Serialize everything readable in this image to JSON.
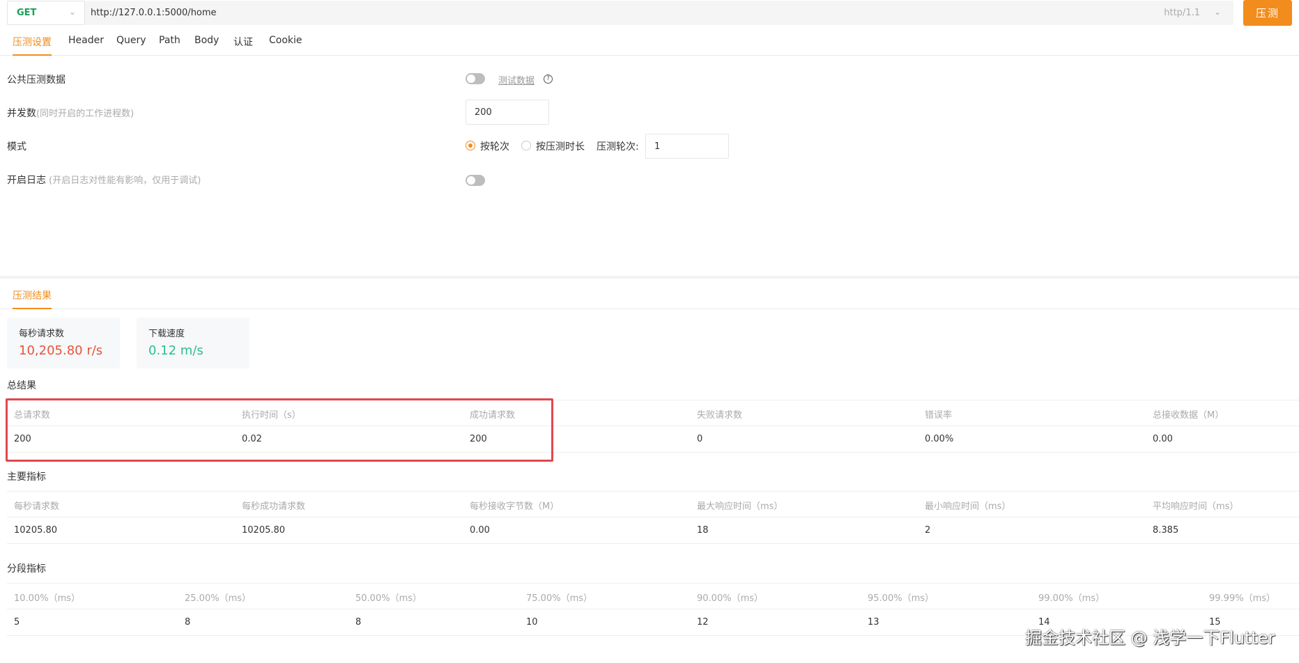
{
  "request": {
    "method": "GET",
    "url": "http://127.0.0.1:5000/home",
    "protocol": "http/1.1",
    "run_label": "压测"
  },
  "tabs": [
    "压测设置",
    "Header",
    "Query",
    "Path",
    "Body",
    "认证",
    "Cookie"
  ],
  "settings": {
    "public_data_label": "公共压测数据",
    "test_data_link": "测试数据",
    "help_glyph": "?",
    "concurrency_label": "并发数",
    "concurrency_hint": "(同时开启的工作进程数)",
    "concurrency_value": "200",
    "mode_label": "模式",
    "mode_option_rounds": "按轮次",
    "mode_option_duration": "按压测时长",
    "rounds_label": "压测轮次:",
    "rounds_value": "1",
    "log_label": "开启日志",
    "log_hint": " (开启日志对性能有影响，仅用于调试)"
  },
  "result_tab": "压测结果",
  "cards": [
    {
      "label": "每秒请求数",
      "value": "10,205.80 r/s",
      "color": "#e8533e"
    },
    {
      "label": "下载速度",
      "value": "0.12 m/s",
      "color": "#2cbf8c"
    }
  ],
  "summary": {
    "title": "总结果",
    "headers": [
      "总请求数",
      "执行时间（s）",
      "成功请求数",
      "失败请求数",
      "错误率",
      "总接收数据（M）"
    ],
    "values": [
      "200",
      "0.02",
      "200",
      "0",
      "0.00%",
      "0.00"
    ]
  },
  "metrics": {
    "title": "主要指标",
    "headers": [
      "每秒请求数",
      "每秒成功请求数",
      "每秒接收字节数（M）",
      "最大响应时间（ms）",
      "最小响应时间（ms）",
      "平均响应时间（ms）"
    ],
    "values": [
      "10205.80",
      "10205.80",
      "0.00",
      "18",
      "2",
      "8.385"
    ]
  },
  "percentiles": {
    "title": "分段指标",
    "headers": [
      "10.00%（ms）",
      "25.00%（ms）",
      "50.00%（ms）",
      "75.00%（ms）",
      "90.00%（ms）",
      "95.00%（ms）",
      "99.00%（ms）",
      "99.99%（ms）"
    ],
    "values": [
      "5",
      "8",
      "8",
      "10",
      "12",
      "13",
      "14",
      "15"
    ]
  },
  "watermark": "掘金技术社区 @ 浅学一下Flutter",
  "colors": {
    "accent": "#f28c1c",
    "method": "#18a058",
    "highlight_box": "#e1474e"
  }
}
